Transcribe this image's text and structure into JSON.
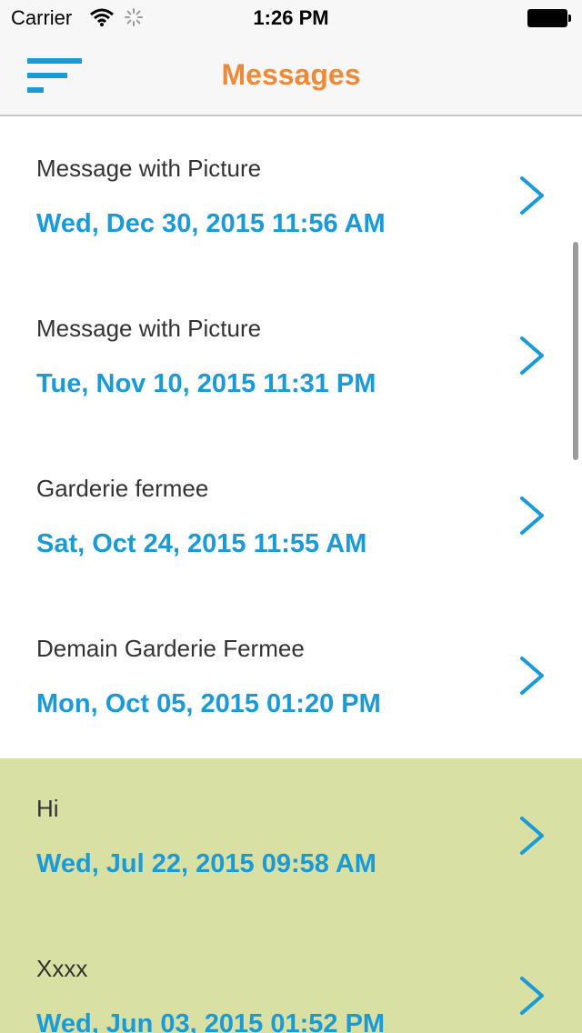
{
  "status_bar": {
    "carrier": "Carrier",
    "time": "1:26 PM"
  },
  "nav": {
    "title": "Messages",
    "menu_icon": "menu-icon",
    "title_color": "#ec8a3a",
    "accent_color": "#1a9ad6"
  },
  "messages": [
    {
      "title": "Message with Picture",
      "date": "Wed, Dec 30, 2015 11:56 AM",
      "highlighted": false
    },
    {
      "title": "Message with Picture",
      "date": "Tue, Nov 10, 2015 11:31 PM",
      "highlighted": false
    },
    {
      "title": "Garderie fermee",
      "date": "Sat, Oct 24, 2015 11:55 AM",
      "highlighted": false
    },
    {
      "title": "Demain Garderie Fermee",
      "date": "Mon, Oct 05, 2015 01:20 PM",
      "highlighted": false
    },
    {
      "title": "Hi",
      "date": "Wed, Jul 22, 2015 09:58 AM",
      "highlighted": true
    },
    {
      "title": "Xxxx",
      "date": "Wed, Jun 03, 2015 01:52 PM",
      "highlighted": true
    }
  ],
  "colors": {
    "highlight_row": "#d8e0a4",
    "date_text": "#1a9ad6",
    "title_text": "#333333"
  }
}
